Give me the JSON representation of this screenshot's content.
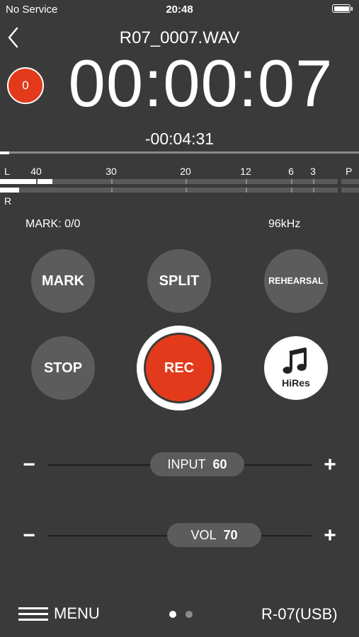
{
  "status_bar": {
    "carrier": "No Service",
    "time": "20:48"
  },
  "header": {
    "file_name": "R07_0007.WAV",
    "mark_count": "0",
    "elapsed_time": "00:00:07",
    "remaining_time": "-00:04:31"
  },
  "progress": {
    "fraction": 0.025
  },
  "meter": {
    "left_label": "L",
    "right_label": "R",
    "peak_label": "P",
    "scale": [
      "40",
      "30",
      "20",
      "12",
      "6",
      "3"
    ],
    "left_level_fraction": 0.107,
    "left_peak": true,
    "right_level_fraction": 0.057
  },
  "info": {
    "mark": "MARK: 0/0",
    "sample_rate": "96kHz"
  },
  "buttons": {
    "mark": "MARK",
    "split": "SPLIT",
    "rehearsal": "REHEARSAL",
    "stop": "STOP",
    "rec": "REC",
    "hires": "HiRes"
  },
  "input": {
    "label": "INPUT",
    "value": "60",
    "minus": "−",
    "plus": "+"
  },
  "volume": {
    "label": "VOL",
    "value": "70",
    "minus": "−",
    "plus": "+"
  },
  "footer": {
    "menu": "MENU",
    "device": "R-07(USB)",
    "page_count": 2,
    "active_page": 1
  },
  "colors": {
    "background": "#3a3a3a",
    "accent_red": "#e23a1b",
    "button_grey": "#5c5c5c"
  }
}
